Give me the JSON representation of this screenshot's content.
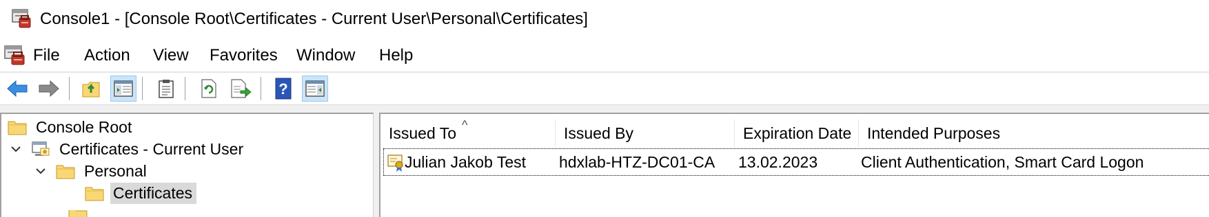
{
  "window": {
    "title": "Console1 - [Console Root\\Certificates - Current User\\Personal\\Certificates]",
    "title_icon": "mmc-console-icon"
  },
  "menu": {
    "icon": "mmc-console-icon",
    "items": [
      "File",
      "Action",
      "View",
      "Favorites",
      "Window",
      "Help"
    ]
  },
  "toolbar": {
    "buttons": [
      "back-arrow-icon",
      "forward-arrow-icon",
      "up-folder-icon",
      "show-hide-console-tree-icon",
      "clipboard-icon",
      "refresh-icon",
      "export-list-icon",
      "help-icon",
      "show-hide-action-pane-icon"
    ],
    "pressed": [
      "show-hide-console-tree-icon",
      "show-hide-action-pane-icon"
    ]
  },
  "tree": {
    "items": [
      {
        "label": "Console Root",
        "icon": "folder-icon"
      },
      {
        "label": "Certificates - Current User",
        "icon": "certificate-store-icon",
        "expanded": true
      },
      {
        "label": "Personal",
        "icon": "folder-icon",
        "expanded": true
      },
      {
        "label": "Certificates",
        "icon": "folder-icon",
        "selected": true
      }
    ]
  },
  "list": {
    "columns": [
      "Issued To",
      "Issued By",
      "Expiration Date",
      "Intended Purposes"
    ],
    "sorted_column": "Issued To",
    "rows": [
      {
        "issued_to": "Julian Jakob Test",
        "issued_by": "hdxlab-HTZ-DC01-CA",
        "expiration": "13.02.2023",
        "purposes": "Client Authentication, Smart Card Logon",
        "icon": "certificate-icon"
      }
    ]
  },
  "colors": {
    "selection": "#d9d9d9",
    "pressed_button": "#cce4f7",
    "pressed_border": "#99c9ef",
    "folder_yellow": "#f8d775",
    "help_blue": "#2b56b8"
  }
}
